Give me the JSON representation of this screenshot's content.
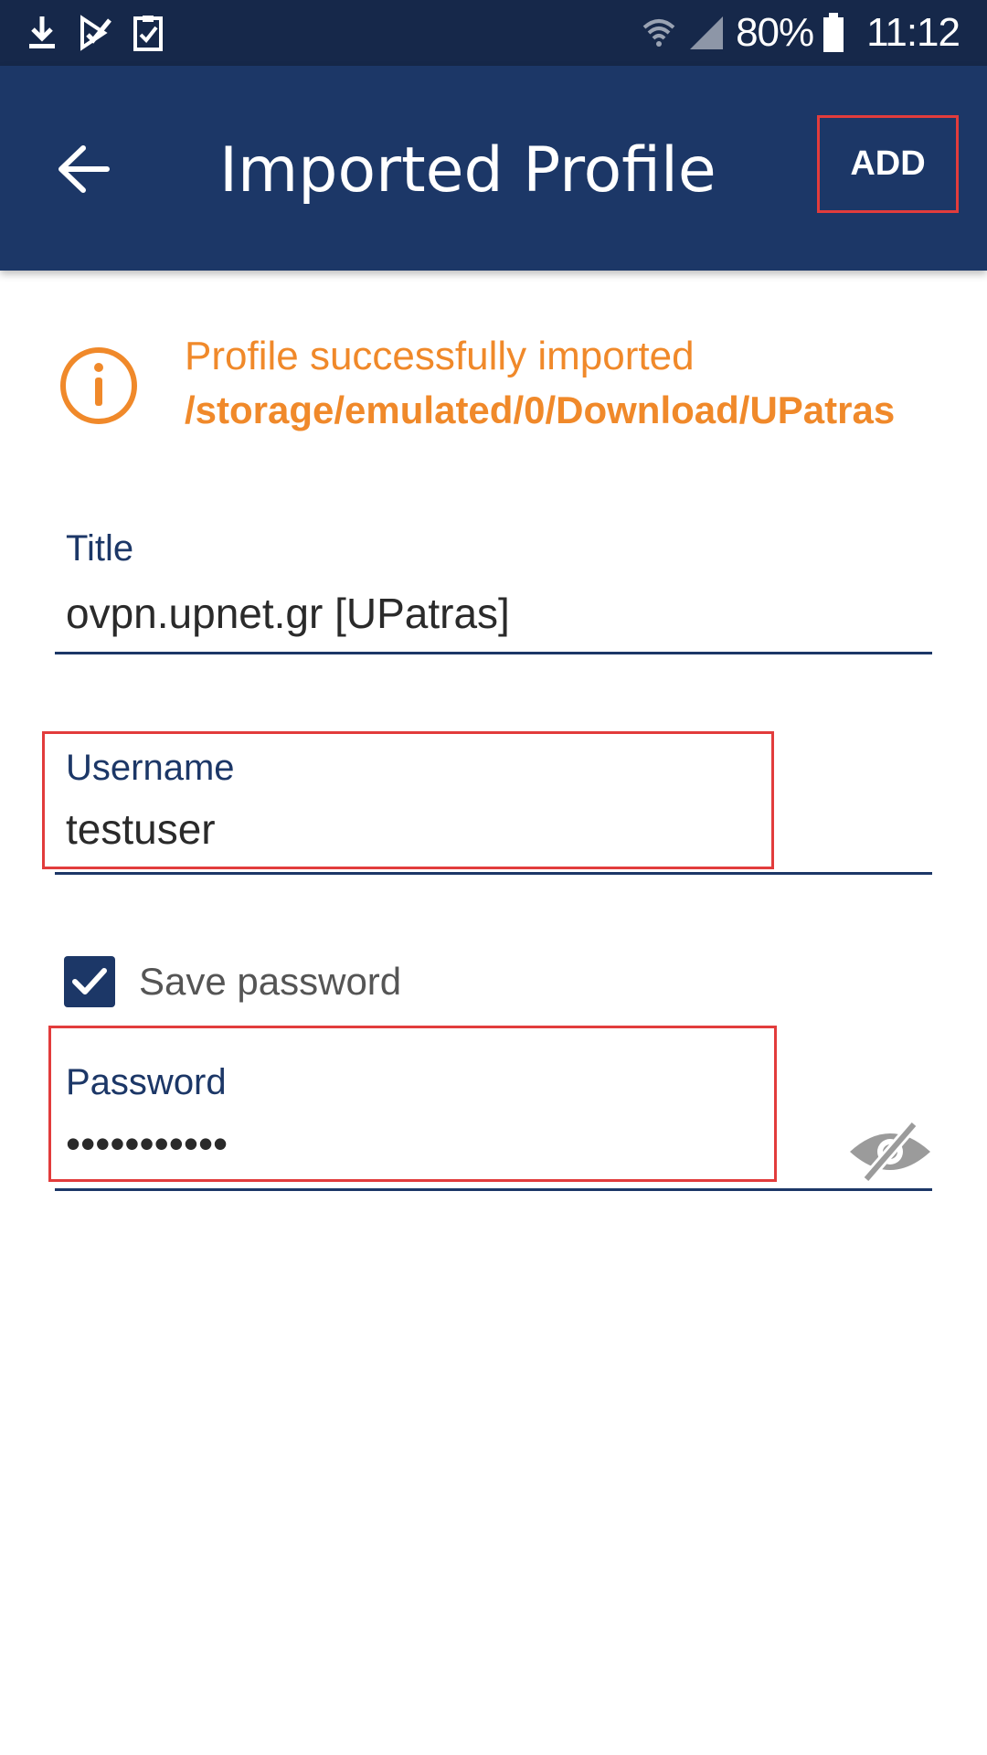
{
  "status_bar": {
    "battery_percent": "80%",
    "time": "11:12",
    "left_icons": [
      "download-icon",
      "task-check-icon",
      "clipboard-check-icon"
    ],
    "right_icons": [
      "wifi-icon",
      "cell-signal-icon",
      "battery-icon"
    ]
  },
  "app_bar": {
    "title": "Imported Profile",
    "back_icon": "arrow-left-icon",
    "add_label": "ADD"
  },
  "info": {
    "icon": "info-circle-icon",
    "message": "Profile successfully imported",
    "path": "/storage/emulated/0/Download/UPatras"
  },
  "form": {
    "title": {
      "label": "Title",
      "value": "ovpn.upnet.gr [UPatras]"
    },
    "username": {
      "label": "Username",
      "value": "testuser"
    },
    "save_password": {
      "label": "Save password",
      "checked": true
    },
    "password": {
      "label": "Password",
      "value": "•••••••••••",
      "toggle_icon": "eye-off-icon"
    }
  },
  "colors": {
    "status_bar": "#16284a",
    "app_bar": "#1c3767",
    "accent_orange": "#f0892a",
    "highlight_red": "#e23c3c",
    "label_blue": "#1c3767"
  }
}
